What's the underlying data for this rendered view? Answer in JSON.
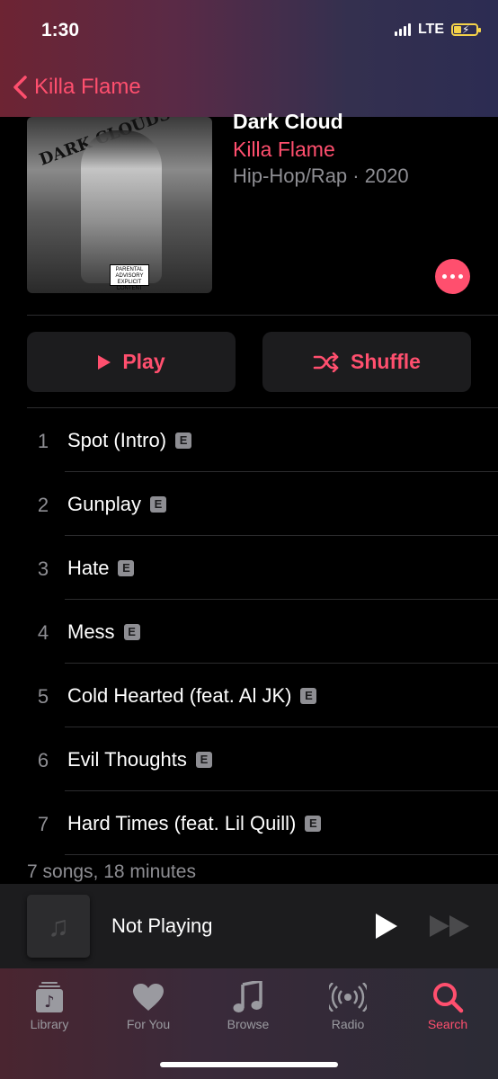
{
  "status_bar": {
    "time": "1:30",
    "network": "LTE"
  },
  "nav": {
    "back_label": "Killa Flame"
  },
  "album": {
    "title": "Dark Cloud",
    "artist": "Killa Flame",
    "meta": "Hip-Hop/Rap · 2020",
    "art_text": "DARK CLOUDS",
    "advisory_text": "PARENTAL ADVISORY EXPLICIT CONTENT"
  },
  "actions": {
    "play_label": "Play",
    "shuffle_label": "Shuffle"
  },
  "tracks": [
    {
      "number": "1",
      "title": "Spot (Intro)",
      "explicit": "E"
    },
    {
      "number": "2",
      "title": "Gunplay",
      "explicit": "E"
    },
    {
      "number": "3",
      "title": "Hate",
      "explicit": "E"
    },
    {
      "number": "4",
      "title": "Mess",
      "explicit": "E"
    },
    {
      "number": "5",
      "title": "Cold Hearted (feat. Al JK)",
      "explicit": "E"
    },
    {
      "number": "6",
      "title": "Evil Thoughts",
      "explicit": "E"
    },
    {
      "number": "7",
      "title": "Hard Times (feat. Lil Quill)",
      "explicit": "E"
    }
  ],
  "summary": "7 songs, 18 minutes",
  "mini_player": {
    "title": "Not Playing"
  },
  "tabs": [
    {
      "label": "Library",
      "icon": "library-icon"
    },
    {
      "label": "For You",
      "icon": "heart-icon"
    },
    {
      "label": "Browse",
      "icon": "music-note-icon"
    },
    {
      "label": "Radio",
      "icon": "radio-icon"
    },
    {
      "label": "Search",
      "icon": "search-icon",
      "active": true
    }
  ],
  "colors": {
    "accent": "#ff4f6e",
    "background": "#000000",
    "secondary_text": "#8e8e93"
  }
}
